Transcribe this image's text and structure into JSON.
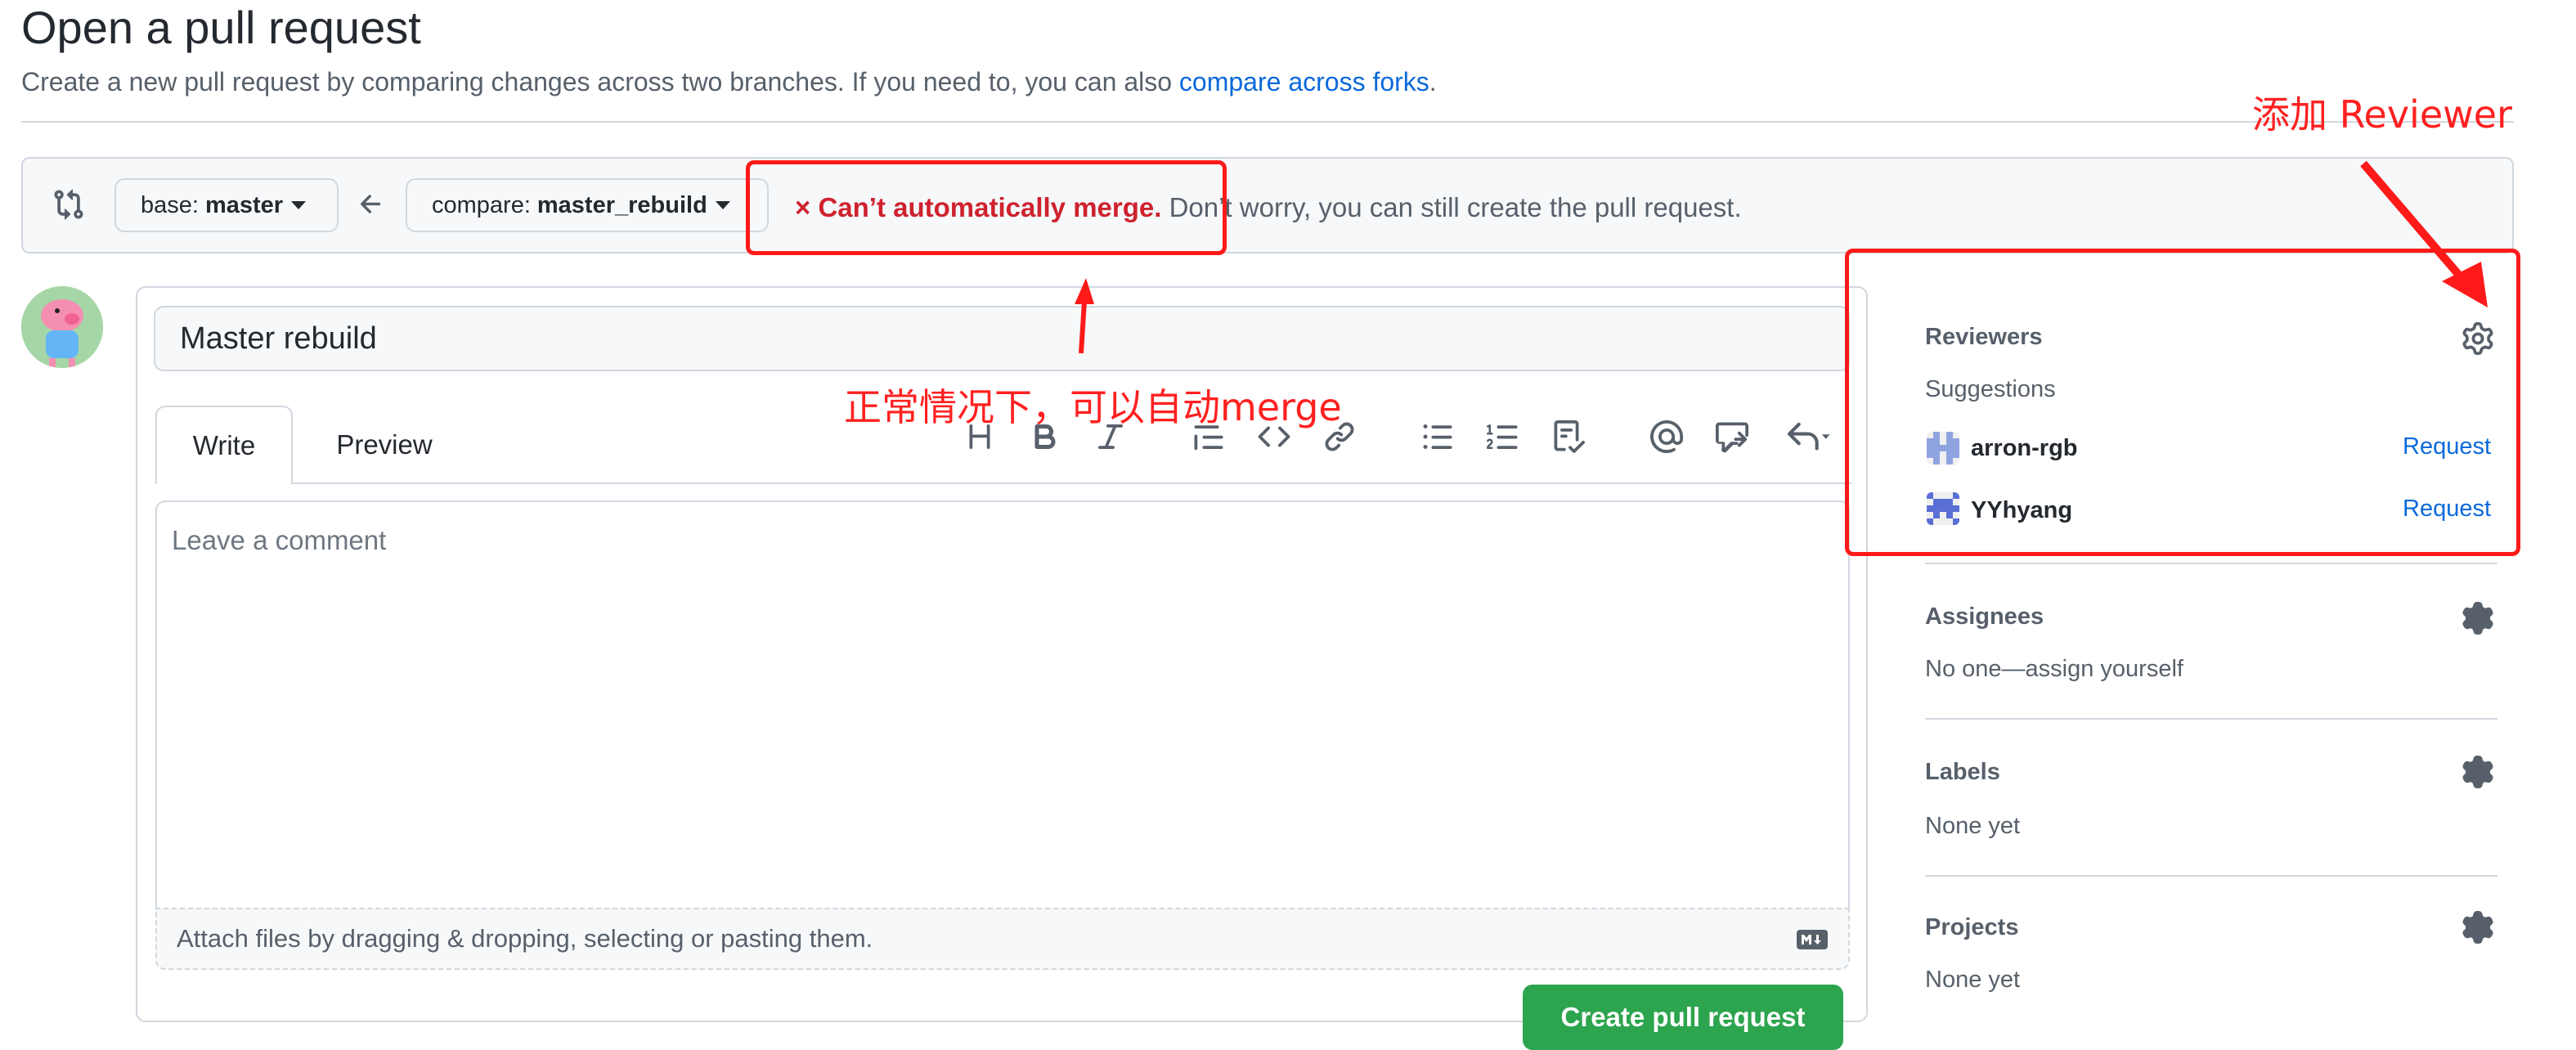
{
  "header": {
    "title": "Open a pull request",
    "subtitle_prefix": "Create a new pull request by comparing changes across two branches. If you need to, you can also ",
    "subtitle_link": "compare across forks",
    "subtitle_suffix": "."
  },
  "compare": {
    "base_label": "base:",
    "base_value": "master",
    "compare_label": "compare:",
    "compare_value": "master_rebuild",
    "merge_status_icon": "×",
    "merge_status_strong": "Can’t automatically merge.",
    "merge_status_rest": " Don’t worry, you can still create the pull request."
  },
  "editor": {
    "title_value": "Master rebuild",
    "tabs": [
      "Write",
      "Preview"
    ],
    "comment_placeholder": "Leave a comment",
    "attach_text": "Attach files by dragging & dropping, selecting or pasting them.",
    "toolbar_icons": [
      "heading-icon",
      "bold-icon",
      "italic-icon",
      "quote-icon",
      "code-icon",
      "link-icon",
      "bulleted-list-icon",
      "numbered-list-icon",
      "task-list-icon",
      "mention-icon",
      "reference-icon",
      "reply-icon"
    ],
    "submit_label": "Create pull request"
  },
  "sidebar": {
    "reviewers": {
      "heading": "Reviewers",
      "suggestions_label": "Suggestions",
      "items": [
        {
          "name": "arron-rgb",
          "action": "Request"
        },
        {
          "name": "YYhyang",
          "action": "Request"
        }
      ]
    },
    "assignees": {
      "heading": "Assignees",
      "value": "No one—assign yourself"
    },
    "labels": {
      "heading": "Labels",
      "value": "None yet"
    },
    "projects": {
      "heading": "Projects",
      "value": "None yet"
    }
  },
  "annotations": {
    "add_reviewer": "添加 Reviewer",
    "normal_merge": "正常情况下，可以自动merge",
    "color": "#ff2020"
  },
  "colors": {
    "link": "#0969da",
    "danger": "#cf222e",
    "primary_button": "#2da44e",
    "border": "#d0d7de"
  }
}
